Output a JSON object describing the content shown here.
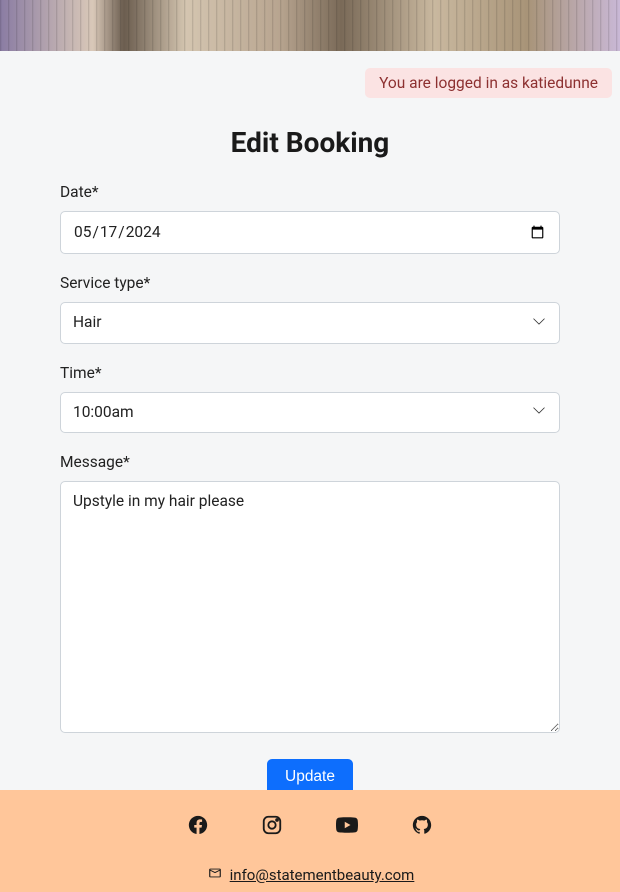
{
  "login_status": "You are logged in as katiedunne",
  "page_title": "Edit Booking",
  "labels": {
    "date": "Date*",
    "service_type": "Service type*",
    "time": "Time*",
    "message": "Message*"
  },
  "form": {
    "date_value": "2024-05-17",
    "service_type_value": "Hair",
    "time_value": "10:00am",
    "message_value": "Upstyle in my hair please"
  },
  "submit_label": "Update",
  "footer": {
    "email": "info@statementbeauty.com"
  }
}
